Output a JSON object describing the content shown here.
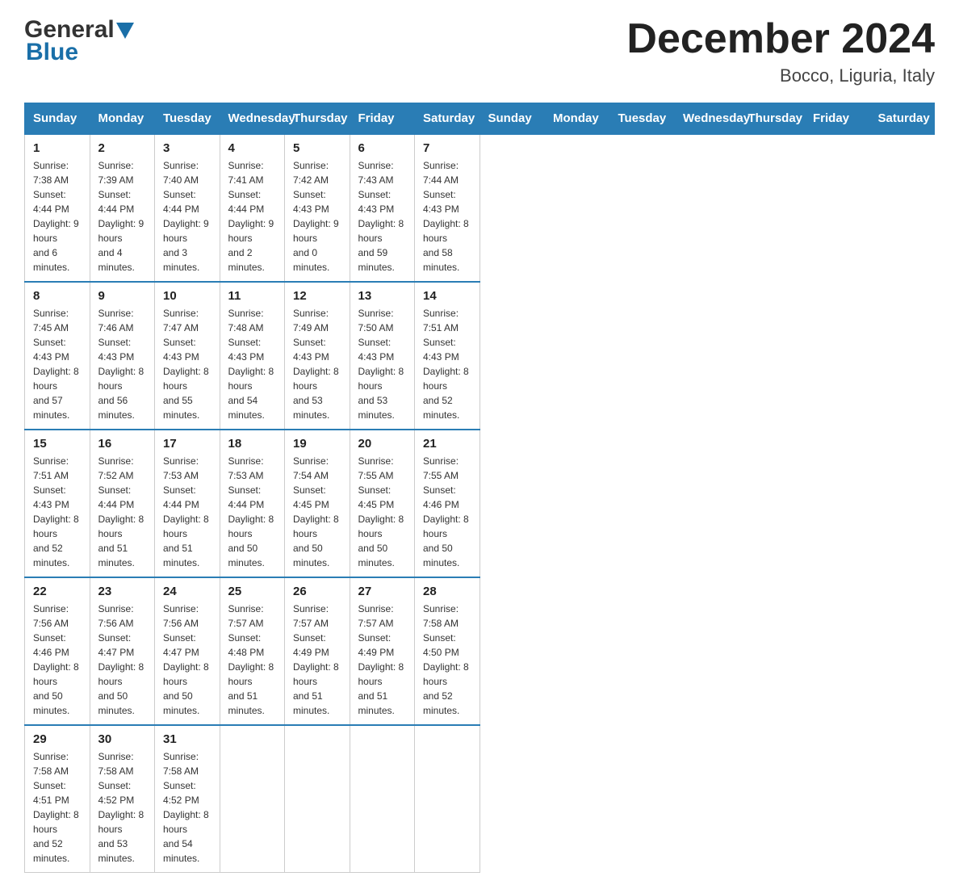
{
  "header": {
    "logo_general": "General",
    "logo_blue": "Blue",
    "month_title": "December 2024",
    "location": "Bocco, Liguria, Italy"
  },
  "days_of_week": [
    "Sunday",
    "Monday",
    "Tuesday",
    "Wednesday",
    "Thursday",
    "Friday",
    "Saturday"
  ],
  "weeks": [
    [
      {
        "num": "1",
        "sunrise": "7:38 AM",
        "sunset": "4:44 PM",
        "daylight": "9 hours and 6 minutes."
      },
      {
        "num": "2",
        "sunrise": "7:39 AM",
        "sunset": "4:44 PM",
        "daylight": "9 hours and 4 minutes."
      },
      {
        "num": "3",
        "sunrise": "7:40 AM",
        "sunset": "4:44 PM",
        "daylight": "9 hours and 3 minutes."
      },
      {
        "num": "4",
        "sunrise": "7:41 AM",
        "sunset": "4:44 PM",
        "daylight": "9 hours and 2 minutes."
      },
      {
        "num": "5",
        "sunrise": "7:42 AM",
        "sunset": "4:43 PM",
        "daylight": "9 hours and 0 minutes."
      },
      {
        "num": "6",
        "sunrise": "7:43 AM",
        "sunset": "4:43 PM",
        "daylight": "8 hours and 59 minutes."
      },
      {
        "num": "7",
        "sunrise": "7:44 AM",
        "sunset": "4:43 PM",
        "daylight": "8 hours and 58 minutes."
      }
    ],
    [
      {
        "num": "8",
        "sunrise": "7:45 AM",
        "sunset": "4:43 PM",
        "daylight": "8 hours and 57 minutes."
      },
      {
        "num": "9",
        "sunrise": "7:46 AM",
        "sunset": "4:43 PM",
        "daylight": "8 hours and 56 minutes."
      },
      {
        "num": "10",
        "sunrise": "7:47 AM",
        "sunset": "4:43 PM",
        "daylight": "8 hours and 55 minutes."
      },
      {
        "num": "11",
        "sunrise": "7:48 AM",
        "sunset": "4:43 PM",
        "daylight": "8 hours and 54 minutes."
      },
      {
        "num": "12",
        "sunrise": "7:49 AM",
        "sunset": "4:43 PM",
        "daylight": "8 hours and 53 minutes."
      },
      {
        "num": "13",
        "sunrise": "7:50 AM",
        "sunset": "4:43 PM",
        "daylight": "8 hours and 53 minutes."
      },
      {
        "num": "14",
        "sunrise": "7:51 AM",
        "sunset": "4:43 PM",
        "daylight": "8 hours and 52 minutes."
      }
    ],
    [
      {
        "num": "15",
        "sunrise": "7:51 AM",
        "sunset": "4:43 PM",
        "daylight": "8 hours and 52 minutes."
      },
      {
        "num": "16",
        "sunrise": "7:52 AM",
        "sunset": "4:44 PM",
        "daylight": "8 hours and 51 minutes."
      },
      {
        "num": "17",
        "sunrise": "7:53 AM",
        "sunset": "4:44 PM",
        "daylight": "8 hours and 51 minutes."
      },
      {
        "num": "18",
        "sunrise": "7:53 AM",
        "sunset": "4:44 PM",
        "daylight": "8 hours and 50 minutes."
      },
      {
        "num": "19",
        "sunrise": "7:54 AM",
        "sunset": "4:45 PM",
        "daylight": "8 hours and 50 minutes."
      },
      {
        "num": "20",
        "sunrise": "7:55 AM",
        "sunset": "4:45 PM",
        "daylight": "8 hours and 50 minutes."
      },
      {
        "num": "21",
        "sunrise": "7:55 AM",
        "sunset": "4:46 PM",
        "daylight": "8 hours and 50 minutes."
      }
    ],
    [
      {
        "num": "22",
        "sunrise": "7:56 AM",
        "sunset": "4:46 PM",
        "daylight": "8 hours and 50 minutes."
      },
      {
        "num": "23",
        "sunrise": "7:56 AM",
        "sunset": "4:47 PM",
        "daylight": "8 hours and 50 minutes."
      },
      {
        "num": "24",
        "sunrise": "7:56 AM",
        "sunset": "4:47 PM",
        "daylight": "8 hours and 50 minutes."
      },
      {
        "num": "25",
        "sunrise": "7:57 AM",
        "sunset": "4:48 PM",
        "daylight": "8 hours and 51 minutes."
      },
      {
        "num": "26",
        "sunrise": "7:57 AM",
        "sunset": "4:49 PM",
        "daylight": "8 hours and 51 minutes."
      },
      {
        "num": "27",
        "sunrise": "7:57 AM",
        "sunset": "4:49 PM",
        "daylight": "8 hours and 51 minutes."
      },
      {
        "num": "28",
        "sunrise": "7:58 AM",
        "sunset": "4:50 PM",
        "daylight": "8 hours and 52 minutes."
      }
    ],
    [
      {
        "num": "29",
        "sunrise": "7:58 AM",
        "sunset": "4:51 PM",
        "daylight": "8 hours and 52 minutes."
      },
      {
        "num": "30",
        "sunrise": "7:58 AM",
        "sunset": "4:52 PM",
        "daylight": "8 hours and 53 minutes."
      },
      {
        "num": "31",
        "sunrise": "7:58 AM",
        "sunset": "4:52 PM",
        "daylight": "8 hours and 54 minutes."
      },
      null,
      null,
      null,
      null
    ]
  ]
}
